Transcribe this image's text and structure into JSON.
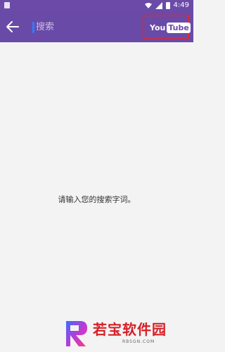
{
  "status_bar": {
    "time": "4:49"
  },
  "app_bar": {
    "back_icon": "arrow-left-icon",
    "search_placeholder": "搜索",
    "youtube_logo": {
      "you": "You",
      "tube": "Tube"
    }
  },
  "content": {
    "empty_message": "请输入您的搜索字词。"
  },
  "watermark": {
    "brand": "若宝软件园",
    "site": "RBSGN.COM"
  },
  "colors": {
    "accent": "#6a4aa7",
    "highlight_box": "#d8293b",
    "cursor": "#2f7cff"
  }
}
